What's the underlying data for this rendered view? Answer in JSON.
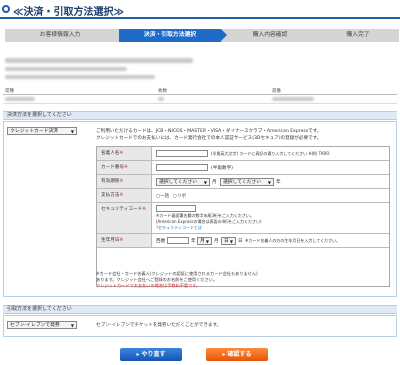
{
  "header": {
    "title": "≪決済・引取方法選択≫"
  },
  "steps": [
    {
      "label": "お客様情報入力"
    },
    {
      "label": "決済・引取方法選択"
    },
    {
      "label": "購入内容確認"
    },
    {
      "label": "購入完了"
    }
  ],
  "info": {
    "col1": "席種",
    "col2": "枚数",
    "col3": "席番"
  },
  "payment": {
    "section_title": "決済方法を選択してください",
    "method_select": "クレジットカード決済",
    "notice_line1": "ご利用いただけるカードは、JCB・NICOS・MASTER・VISA・ダイナースクラブ・American Expressです。",
    "notice_line2": "クレジットカードでのお支払いには、カード発行会社での本人認証サービス(3Dセキュア)の登録が必要です。",
    "form": {
      "name_label": "名義人名",
      "name_required": "※",
      "name_hint": "(半角英大文字) カードに表記の通り入力してください ※例) TARO",
      "card_label": "カード番号",
      "card_required": "※",
      "card_hint": "(半角数字)",
      "expiry_label": "有効期限",
      "expiry_required": "※",
      "expiry_month_select": "選択してください",
      "expiry_month_unit": "月",
      "expiry_year_select": "選択してください",
      "expiry_year_unit": "年",
      "pay_label": "支払方法",
      "pay_required": "※",
      "pay_option1": "一括",
      "pay_option2": "リボ",
      "sec_label": "セキュリティコード",
      "sec_required": "※",
      "sec_hint1": "※カード裏面署名欄の数字末尾3桁をご入力ください。",
      "sec_hint2": "(American Expressの場合は表面の4桁をご入力ください)",
      "sec_link": "セキュリティコードとは",
      "birth_label": "生年月日",
      "birth_required": "※",
      "birth_era": "西暦",
      "birth_year_unit": "年",
      "birth_month_select": "月",
      "birth_month_unit": "月",
      "birth_day_select": "日",
      "birth_day_unit": "日",
      "birth_hint": "※カード名義人の方の生年月日を入力してください。"
    },
    "footnote1": "※カード会社・カード名義人(クレジットの認証に使用されるカード会社もありません)",
    "footnote2": "あります。クレジット会社へご登録のお名前をご使用ください。",
    "footnote3": "クレジットカードでお支払いの場合は手数料不要です。"
  },
  "pickup": {
    "section_title": "引取方法を選択してください",
    "method_select": "セブン-イレブンで発券",
    "notice": "セブン-イレブンでチケットを発券いただくことができます。"
  },
  "buttons": {
    "back": "やり直す",
    "confirm": "確認する"
  }
}
